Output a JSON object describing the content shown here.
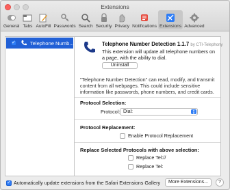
{
  "window": {
    "title": "Extensions"
  },
  "toolbar": {
    "items": [
      {
        "label": "General",
        "icon": "general-switch-icon"
      },
      {
        "label": "Tabs",
        "icon": "tabs-icon"
      },
      {
        "label": "AutoFill",
        "icon": "autofill-pencil-icon"
      },
      {
        "label": "Passwords",
        "icon": "key-icon"
      },
      {
        "label": "Search",
        "icon": "search-icon"
      },
      {
        "label": "Security",
        "icon": "lock-icon"
      },
      {
        "label": "Privacy",
        "icon": "hand-icon"
      },
      {
        "label": "Notifications",
        "icon": "bell-icon"
      },
      {
        "label": "Extensions",
        "icon": "puzzle-icon",
        "active": true
      },
      {
        "label": "Advanced",
        "icon": "gear-icon"
      }
    ]
  },
  "extensions_list": {
    "items": [
      {
        "name": "Telephone Numb...",
        "enabled": true,
        "selected": true
      }
    ]
  },
  "details": {
    "name": "Telephone Number Detection 1.1.7",
    "author": "by CTI-Telephony",
    "description": "This extension will update all telephone numbers on a page, with the ability to dial.",
    "uninstall_label": "Uninstall",
    "warning": "\"Telephone Number Detection\" can read, modify, and transmit content from all webpages. This could include sensitive information like passwords, phone numbers, and credit cards.",
    "protocol_selection": {
      "title": "Protocol Selection:",
      "label": "Protocol:",
      "value": "Dial:"
    },
    "protocol_replacement": {
      "title": "Protocol Replacement:",
      "checkbox_label": "Enable Protocol Replacement",
      "checked": false
    },
    "replace_selected": {
      "title": "Replace Selected Protocols with above selection:",
      "options": [
        {
          "label": "Replace Tel://",
          "checked": false
        },
        {
          "label": "Replace Tel:",
          "checked": false
        }
      ]
    }
  },
  "footer": {
    "auto_update_label": "Automatically update extensions from the Safari Extensions Gallery",
    "auto_update_checked": true,
    "more_extensions_label": "More Extensions...",
    "help_label": "?"
  },
  "colors": {
    "accent": "#2d7cf6",
    "selection": "#2160d6",
    "close": "#fc615d"
  }
}
